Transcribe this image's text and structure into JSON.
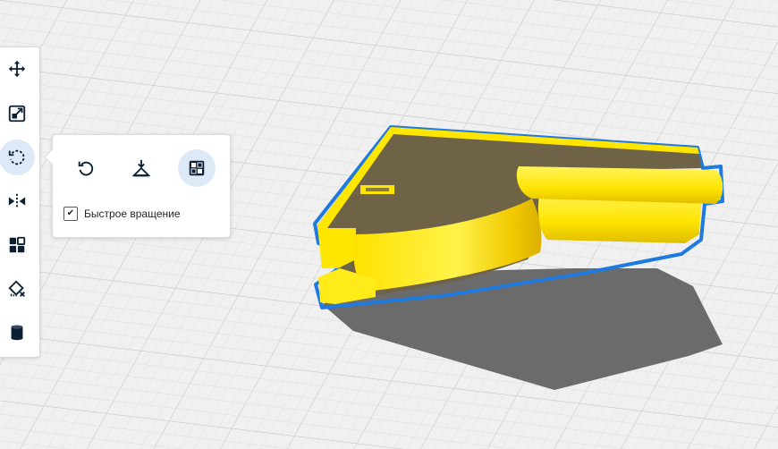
{
  "viewport": {
    "background_color": "#f0f0f0",
    "grid_color": "#d6d6d6",
    "model_color": "#ffe600",
    "model_dark_color": "#6e6347",
    "outline_color": "#1f7ae0",
    "shadow_color": "#6b6b6b"
  },
  "toolbar": {
    "tools": [
      {
        "name": "move",
        "icon": "move-arrows-icon",
        "active": false
      },
      {
        "name": "scale",
        "icon": "scale-icon",
        "active": false
      },
      {
        "name": "rotate",
        "icon": "rotate-icon",
        "active": true
      },
      {
        "name": "mirror",
        "icon": "mirror-icon",
        "active": false
      },
      {
        "name": "per-model-settings",
        "icon": "per-model-settings-icon",
        "active": false
      },
      {
        "name": "support-blocker",
        "icon": "support-blocker-icon",
        "active": false
      },
      {
        "name": "cylinder",
        "icon": "cylinder-icon",
        "active": false
      }
    ]
  },
  "rotate_panel": {
    "buttons": [
      {
        "name": "reset-rotation",
        "icon": "reset-rotation-icon",
        "active": false
      },
      {
        "name": "lay-flat",
        "icon": "lay-flat-icon",
        "active": false
      },
      {
        "name": "select-face-to-align",
        "icon": "select-face-icon",
        "active": true
      }
    ],
    "fast_rotation_checked": true,
    "fast_rotation_label": "Быстрое вращение"
  },
  "accent_color": "#1a5fb4"
}
